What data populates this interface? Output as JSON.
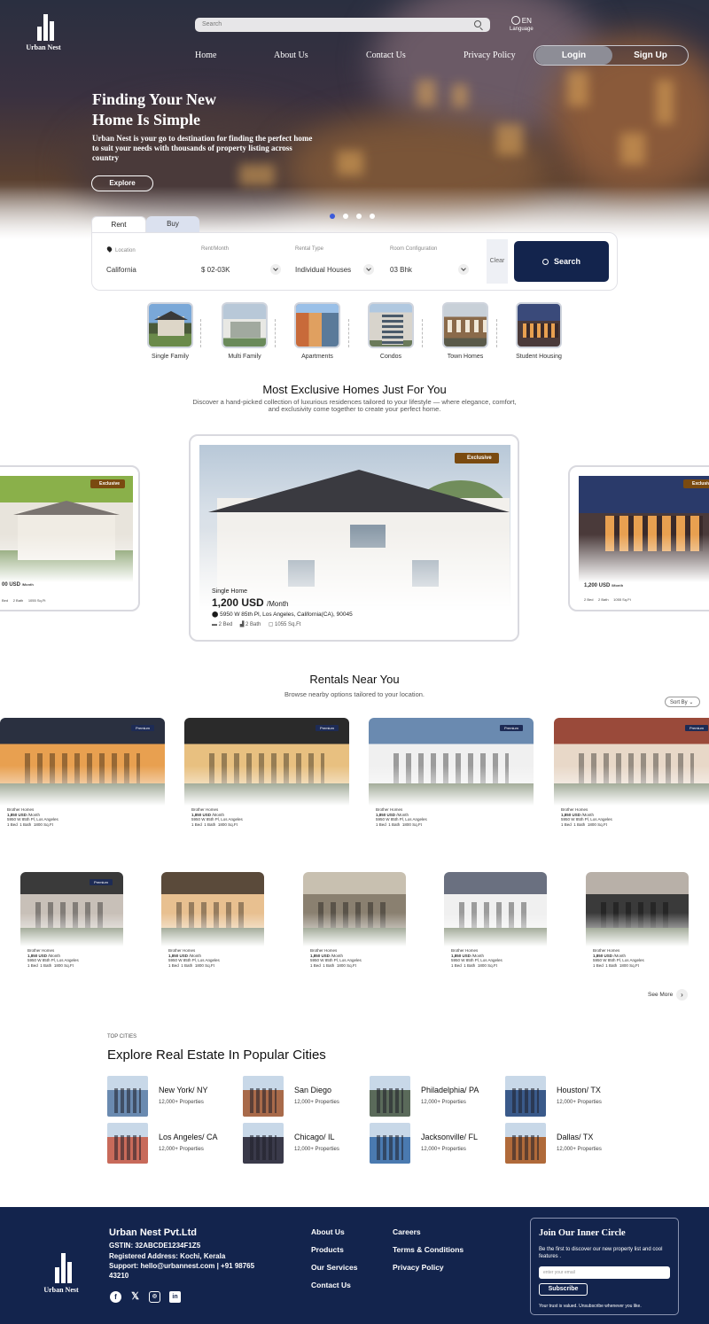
{
  "brand": {
    "name": "Urban Nest"
  },
  "header": {
    "search_placeholder": "Search",
    "language_code": "EN",
    "language_label": "Language",
    "nav": [
      "Home",
      "About Us",
      "Contact Us",
      "Privacy Policy"
    ],
    "login": "Login",
    "signup": "Sign Up"
  },
  "hero": {
    "title_line1": "Finding Your New",
    "title_line2": "Home Is Simple",
    "subtitle": "Urban Nest is your go to destination for finding the perfect home to suit your needs with thousands of property listing across country",
    "cta": "Explore",
    "slides": 4,
    "active_slide": 1
  },
  "search_panel": {
    "tabs": [
      "Rent",
      "Buy"
    ],
    "active_tab": "Rent",
    "fields": [
      {
        "label": "Location",
        "value": "California"
      },
      {
        "label": "Rent/Month",
        "value": "$ 02-03K"
      },
      {
        "label": "Rental Type",
        "value": "Individual Houses"
      },
      {
        "label": "Room Configuration",
        "value": "03 Bhk"
      }
    ],
    "clear": "Clear",
    "search": "Search"
  },
  "categories": [
    "Single Family",
    "Multi Family",
    "Apartments",
    "Condos",
    "Town Homes",
    "Student Housing"
  ],
  "exclusive": {
    "title": "Most Exclusive Homes Just For You",
    "subtitle_line1": "Discover a hand-picked collection of luxurious residences tailored to your lifestyle — where elegance, comfort,",
    "subtitle_line2": "and exclusivity come together to create your perfect home.",
    "badge": "Exclusive",
    "featured": {
      "type": "Single Home",
      "price": "1,200 USD",
      "per": "/Month",
      "address": "5950 W 85th Pl, Los Angeles, California(CA), 90045",
      "bed": "2 Bed",
      "bath": "2 Bath",
      "area": "1055 Sq.Ft"
    },
    "left": {
      "price": "00 USD",
      "per": "/Month",
      "bed": "Bed",
      "bath": "2 Bath",
      "area": "1055 Sq.Ft"
    },
    "right": {
      "price": "1,200 USD",
      "per": "/Month",
      "bed": "2 Bed",
      "bath": "2 Bath",
      "area": "1055 Sq.Ft"
    }
  },
  "rentals": {
    "title": "Rentals Near You",
    "subtitle": "Browse nearby options tailored to your location.",
    "sort": "Sort By",
    "premium": "Premium",
    "card": {
      "type": "Brother Homes",
      "price": "1,850 USD",
      "per": "/Month",
      "address": "5950 W 85th Pl, Los Angeles",
      "bed": "1 Bed",
      "bath": "1 Bath",
      "area": "1800 Sq.Ft"
    },
    "see_more": "See More"
  },
  "cities": {
    "eyebrow": "TOP CITIES",
    "title": "Explore Real Estate In Popular Cities",
    "items": [
      {
        "name": "New York/ NY",
        "count": "12,000+  Properties"
      },
      {
        "name": "San Diego",
        "count": "12,000+  Properties"
      },
      {
        "name": "Philadelphia/ PA",
        "count": "12,000+  Properties"
      },
      {
        "name": "Houston/ TX",
        "count": "12,000+  Properties"
      },
      {
        "name": "Los Angeles/ CA",
        "count": "12,000+  Properties"
      },
      {
        "name": "Chicago/ IL",
        "count": "12,000+  Properties"
      },
      {
        "name": "Jacksonville/ FL",
        "count": "12,000+  Properties"
      },
      {
        "name": "Dallas/ TX",
        "count": "12,000+  Properties"
      }
    ]
  },
  "footer": {
    "company": "Urban Nest Pvt.Ltd",
    "gstin": "GSTIN: 32ABCDE1234F1Z5",
    "address": "Registered Address: Kochi, Kerala",
    "support": "Support: hello@urbannest.com | +91 98765 43210",
    "links_col1": [
      "About Us",
      "Products",
      "Our Services",
      "Contact Us"
    ],
    "links_col2": [
      "Careers",
      "Terms & Conditions",
      "Privacy Policy"
    ],
    "social": [
      "facebook-icon",
      "x-icon",
      "instagram-icon",
      "linkedin-icon"
    ],
    "newsletter": {
      "title": "Join Our Inner Circle",
      "desc": "Be the first to discover our new property list and cool features .",
      "placeholder": "enter your email",
      "button": "Subscribe",
      "note": "Your trust is valued. Unsubscribe whenever you like."
    }
  },
  "colors": {
    "navy": "#13244D",
    "badge": "#7A4A10",
    "accent_dot": "#3B5BDB"
  }
}
